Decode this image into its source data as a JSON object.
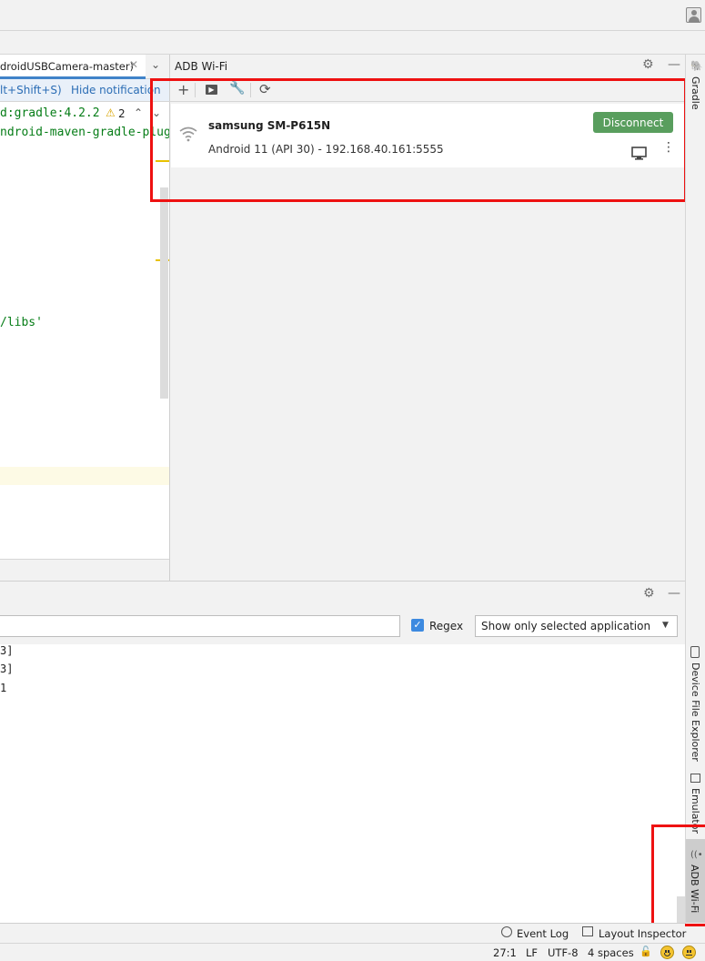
{
  "window": {
    "avatar_icon": "user-avatar-icon"
  },
  "editor": {
    "tab_label": "droidUSBCamera-master)",
    "notification_shortcut": "lt+Shift+S)",
    "notification_hide": "Hide notification",
    "code_lines": [
      "d:gradle:4.2.2",
      "ndroid-maven-gradle-plug",
      "/libs'"
    ],
    "warning_count": "2"
  },
  "adb_wifi": {
    "title": "ADB Wi-Fi",
    "toolbar_icons": [
      "plus-icon",
      "terminal-icon",
      "wrench-icon",
      "refresh-icon"
    ],
    "device": {
      "name": "samsung SM-P615N",
      "details": "Android 11 (API 30) - 192.168.40.161:5555",
      "disconnect_label": "Disconnect"
    }
  },
  "logcat": {
    "search_value": "",
    "regex_label": "Regex",
    "regex_checked": true,
    "filter_select": "Show only selected application",
    "log_lines": [
      "3]",
      "3]",
      "1"
    ]
  },
  "right_strip": {
    "gradle": "Gradle",
    "device_file_explorer": "Device File Explorer",
    "emulator": "Emulator",
    "adb_wifi": "ADB Wi-Fi"
  },
  "tool_windows": {
    "event_log": "Event Log",
    "layout_inspector": "Layout Inspector"
  },
  "status_bar": {
    "position": "27:1",
    "line_ending": "LF",
    "encoding": "UTF-8",
    "indent": "4 spaces"
  },
  "colors": {
    "disconnect_button": "#599e5e",
    "highlight_box": "#ee1111",
    "accent_blue": "#3d8ae0"
  }
}
